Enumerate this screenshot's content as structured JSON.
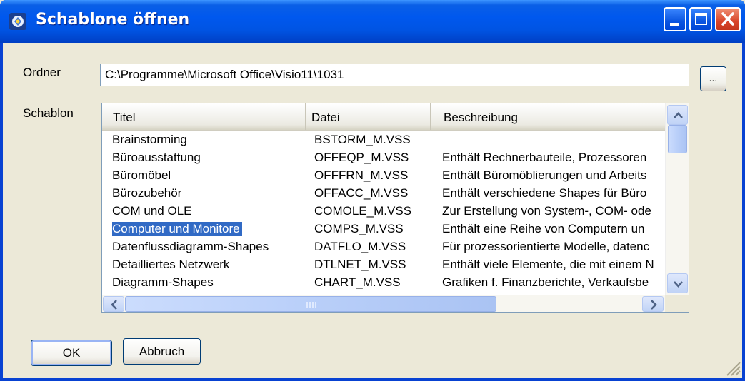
{
  "window": {
    "title": "Schablone öffnen",
    "controls": [
      "minimize-icon",
      "maximize-icon",
      "close-icon"
    ]
  },
  "folder": {
    "label": "Ordner",
    "path": "C:\\Programme\\Microsoft Office\\Visio11\\1031",
    "browse_label": "..."
  },
  "stencil": {
    "label": "Schablon",
    "columns": [
      "Titel",
      "Datei",
      "Beschreibung"
    ],
    "rows": [
      {
        "title": "Brainstorming",
        "file": "BSTORM_M.VSS",
        "description": ""
      },
      {
        "title": "Büroausstattung",
        "file": "OFFEQP_M.VSS",
        "description": "Enthält Rechnerbauteile, Prozessoren"
      },
      {
        "title": "Büromöbel",
        "file": "OFFFRN_M.VSS",
        "description": "Enthält Büromöblierungen und Arbeits"
      },
      {
        "title": "Bürozubehör",
        "file": "OFFACC_M.VSS",
        "description": "Enthält verschiedene Shapes für Büro"
      },
      {
        "title": "COM und OLE",
        "file": "COMOLE_M.VSS",
        "description": "Zur Erstellung von System-, COM- ode"
      },
      {
        "title": "Computer und Monitore",
        "file": "COMPS_M.VSS",
        "description": "Enthält eine Reihe von Computern un"
      },
      {
        "title": "Datenflussdiagramm-Shapes",
        "file": "DATFLO_M.VSS",
        "description": "Für prozessorientierte Modelle, datenc"
      },
      {
        "title": "Detailliertes Netzwerk",
        "file": "DTLNET_M.VSS",
        "description": "Enthält viele Elemente, die mit einem N"
      },
      {
        "title": "Diagramm-Shapes",
        "file": "CHART_M.VSS",
        "description": "Grafiken f. Finanzberichte, Verkaufsbe"
      }
    ],
    "selected_title": "Computer und Monitore"
  },
  "buttons": {
    "ok": "OK",
    "cancel": "Abbruch"
  },
  "colors": {
    "titlebar": "#0054e3",
    "selection": "#316ac5",
    "dialog_bg": "#ece9d8"
  }
}
